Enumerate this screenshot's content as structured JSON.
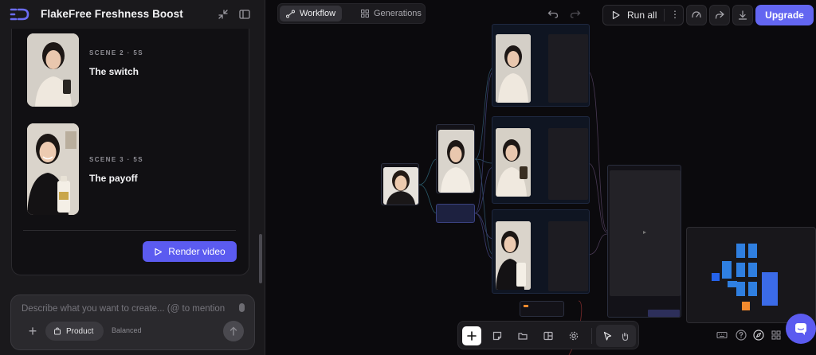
{
  "app": {
    "title": "FlakeFree Freshness Boost"
  },
  "scenes": [
    {
      "meta": "SCENE 2 · 5S",
      "title": "The switch"
    },
    {
      "meta": "SCENE 3 · 5S",
      "title": "The payoff"
    }
  ],
  "actions": {
    "render_video": "Render video"
  },
  "composer": {
    "placeholder": "Describe what you want to create... (@ to mention",
    "product_chip": "Product",
    "mode_chip": "Balanced"
  },
  "toolbar": {
    "tab_workflow": "Workflow",
    "tab_generations": "Generations",
    "run_all": "Run all",
    "upgrade": "Upgrade"
  },
  "colors": {
    "accent": "#6366f1",
    "panel_bg": "#1a191c",
    "canvas_bg": "#0b0a0d",
    "minimap_block": "#2f7fe0",
    "minimap_highlight": "#f28a2e"
  },
  "icons": {
    "logo": "brand-logo-icon",
    "collapse": "collapse-icon",
    "sidebar_toggle": "sidebar-toggle-icon",
    "undo": "undo-icon",
    "redo": "redo-icon",
    "play": "play-icon",
    "more": "more-vertical-icon",
    "gauge": "gauge-icon",
    "share": "share-icon",
    "download": "download-icon",
    "add": "plus-icon",
    "sticky": "sticky-note-icon",
    "folder": "folder-icon",
    "layout": "layout-icon",
    "settings": "gear-icon",
    "pointer": "pointer-icon",
    "hand": "hand-icon",
    "keyboard": "keyboard-icon",
    "help": "help-icon",
    "compass": "compass-icon",
    "grid": "grid-icon",
    "chat": "chat-icon"
  }
}
